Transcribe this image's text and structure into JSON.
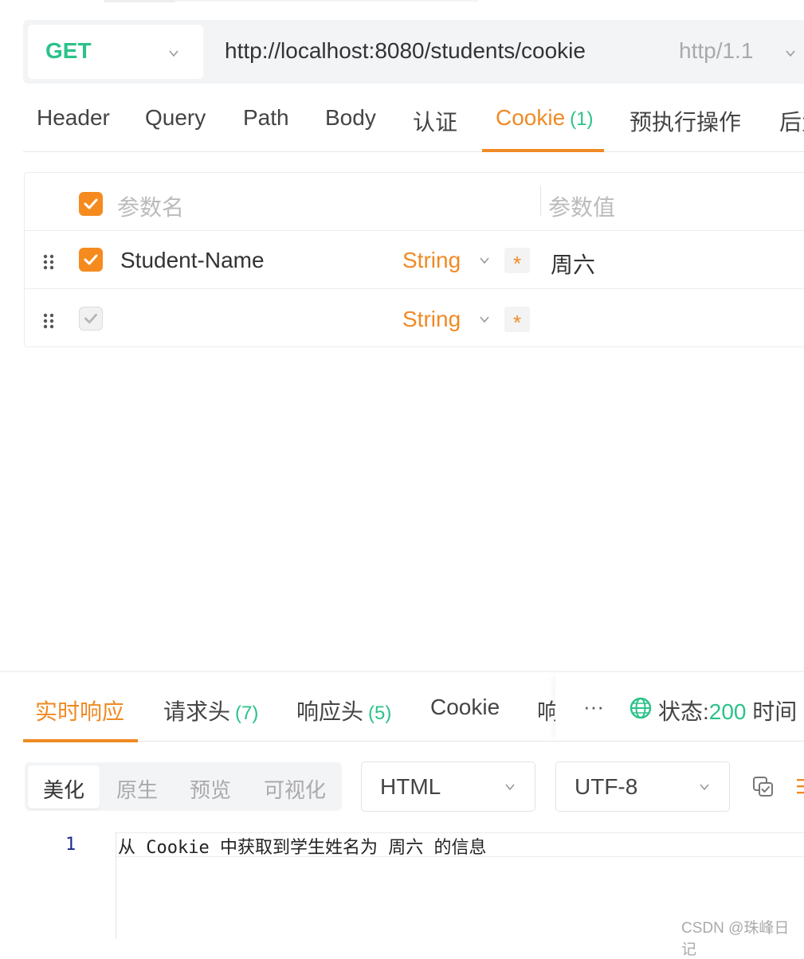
{
  "request": {
    "method": "GET",
    "url": "http://localhost:8080/students/cookie",
    "protocol": "http/1.1"
  },
  "request_tabs": [
    {
      "label": "Header"
    },
    {
      "label": "Query"
    },
    {
      "label": "Path"
    },
    {
      "label": "Body"
    },
    {
      "label": "认证"
    },
    {
      "label": "Cookie",
      "count": "(1)",
      "active": true
    },
    {
      "label": "预执行操作"
    },
    {
      "label": "后置"
    }
  ],
  "params_table": {
    "header": {
      "name": "参数名",
      "value": "参数值"
    },
    "rows": [
      {
        "checked": true,
        "name": "Student-Name",
        "type": "String",
        "required_mark": "*",
        "value": "周六"
      },
      {
        "checked": false,
        "name": "",
        "type": "String",
        "required_mark": "*",
        "value": ""
      }
    ]
  },
  "response_tabs": [
    {
      "label": "实时响应",
      "active": true
    },
    {
      "label": "请求头",
      "count": "(7)"
    },
    {
      "label": "响应头",
      "count": "(5)"
    },
    {
      "label": "Cookie"
    },
    {
      "label": "响"
    }
  ],
  "response_more": "···",
  "status": {
    "label": "状态:",
    "code": "200",
    "trailing": "时间"
  },
  "view_modes": [
    {
      "label": "美化",
      "active": true
    },
    {
      "label": "原生"
    },
    {
      "label": "预览"
    },
    {
      "label": "可视化"
    }
  ],
  "format_select": "HTML",
  "encoding_select": "UTF-8",
  "code": {
    "line_number": "1",
    "text": "从 Cookie 中获取到学生姓名为 周六 的信息"
  },
  "watermark": "CSDN @珠峰日记",
  "colors": {
    "accent": "#f08a24",
    "success": "#2bc28a"
  },
  "icons": [
    "chevron-down-icon",
    "checkbox-check-icon",
    "drag-handle-icon",
    "globe-icon",
    "copy-icon"
  ]
}
